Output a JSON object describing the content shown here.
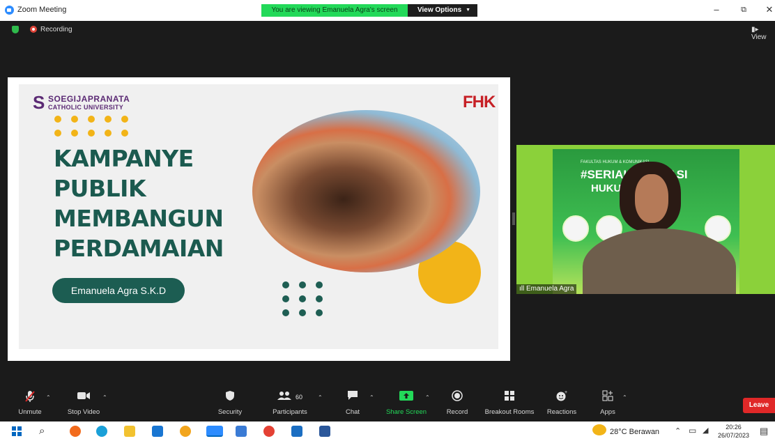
{
  "window": {
    "title": "Zoom Meeting",
    "viewing_banner": "You are viewing Emanuela Agra's screen",
    "view_options": "View Options",
    "minimize": "–",
    "restore": "⧉",
    "close": "✕"
  },
  "status": {
    "recording_label": "Recording",
    "view_label": "View"
  },
  "slide": {
    "university_name": "SOEGIJAPRANATA",
    "university_sub": "CATHOLIC UNIVERSITY",
    "faculty_logo": "FHK",
    "headline": [
      "KAMPANYE",
      "PUBLIK",
      "MEMBANGUN",
      "PERDAMAIAN"
    ],
    "presenter": "Emanuela Agra S.K.D"
  },
  "video": {
    "participant_name": "Emanuela Agra",
    "poster_tag": "FAKULTAS HUKUM & KOMUNIKASI",
    "poster_title_1": "#SERIAL LITERASI",
    "poster_title_2": "HUKUM ISLAM"
  },
  "toolbar": {
    "unmute": "Unmute",
    "stop_video": "Stop Video",
    "security": "Security",
    "participants": "Participants",
    "participants_count": "60",
    "chat": "Chat",
    "share_screen": "Share Screen",
    "record": "Record",
    "breakout_rooms": "Breakout Rooms",
    "reactions": "Reactions",
    "apps": "Apps",
    "leave": "Leave"
  },
  "taskbar": {
    "weather": "28°C Berawan",
    "time": "20:26",
    "date": "26/07/2023"
  },
  "colors": {
    "accent_green": "#23d959",
    "leave_red": "#e02828",
    "slide_green": "#1b5a4f",
    "slide_yellow": "#f2b418"
  }
}
